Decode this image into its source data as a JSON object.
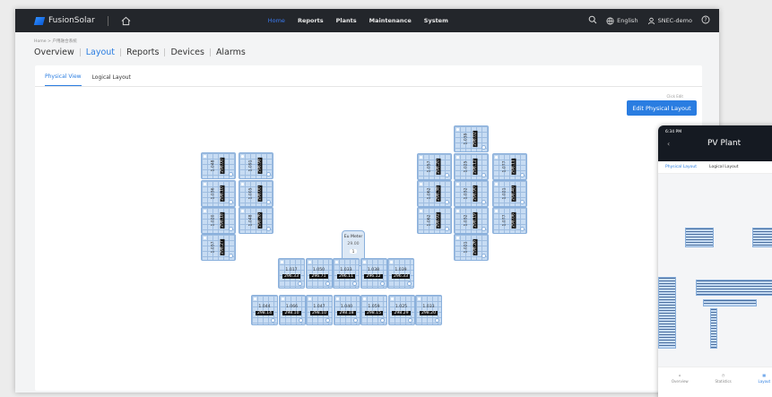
{
  "app": {
    "logo_text": "FusionSolar",
    "nav": [
      {
        "label": "Home",
        "active": true
      },
      {
        "label": "Reports",
        "active": false
      },
      {
        "label": "Plants",
        "active": false
      },
      {
        "label": "Maintenance",
        "active": false
      },
      {
        "label": "System",
        "active": false
      }
    ],
    "language": "English",
    "user": "SNEC-demo"
  },
  "breadcrumb": "Home > 户用融合系统",
  "page_tabs": [
    {
      "label": "Overview",
      "active": false
    },
    {
      "label": "Layout",
      "active": true
    },
    {
      "label": "Reports",
      "active": false
    },
    {
      "label": "Devices",
      "active": false
    },
    {
      "label": "Alarms",
      "active": false
    }
  ],
  "view_tabs": [
    {
      "label": "Physical View",
      "active": true
    },
    {
      "label": "Logical Layout",
      "active": false
    }
  ],
  "click_edit_hint": "Click Edit",
  "edit_button": "Edit Physical Layout",
  "meter": {
    "name": "Eu Meter",
    "value": "29.00",
    "badge": "1"
  },
  "inverters_left": [
    {
      "k": "1.048",
      "v": "298.00"
    },
    {
      "k": "1.091",
      "v": "298.98"
    },
    {
      "k": "1.036",
      "v": "298.10"
    },
    {
      "k": "1.005",
      "v": "298.00"
    },
    {
      "k": "1.020",
      "v": "298.18"
    },
    {
      "k": "1.048",
      "v": "298.26"
    },
    {
      "k": "1.037",
      "v": "298.27"
    }
  ],
  "inverters_right": [
    {
      "k": "1.039",
      "v": "298.02"
    },
    {
      "k": "1.057",
      "v": "298.20"
    },
    {
      "k": "1.025",
      "v": "298.12"
    },
    {
      "k": "1.077",
      "v": "298.11"
    },
    {
      "k": "1.062",
      "v": "298.38"
    },
    {
      "k": "1.032",
      "v": "298.90"
    },
    {
      "k": "1.021",
      "v": "298.40"
    },
    {
      "k": "1.062",
      "v": "298.92"
    },
    {
      "k": "1.032",
      "v": "298.19"
    },
    {
      "k": "1.077",
      "v": "298.06"
    },
    {
      "k": "1.021",
      "v": "298.26"
    }
  ],
  "inverters_row1": [
    {
      "k": "1.017",
      "v": "296.33"
    },
    {
      "k": "1.050",
      "v": "296.71"
    },
    {
      "k": "1.033",
      "v": "296.11"
    },
    {
      "k": "1.038",
      "v": "296.12"
    },
    {
      "k": "1.039",
      "v": "296.33"
    }
  ],
  "inverters_row2": [
    {
      "k": "1.044",
      "v": "298.14"
    },
    {
      "k": "1.066",
      "v": "298.10"
    },
    {
      "k": "1.047",
      "v": "298.10"
    },
    {
      "k": "1.040",
      "v": "298.18"
    },
    {
      "k": "1.059",
      "v": "298.15"
    },
    {
      "k": "1.025",
      "v": "298.29"
    },
    {
      "k": "1.033",
      "v": "298.20"
    }
  ],
  "phone": {
    "time": "6:34 PM",
    "title": "PV Plant",
    "tabs": [
      {
        "label": "Physical Layout",
        "active": true
      },
      {
        "label": "Logical Layout",
        "active": false
      }
    ],
    "bottom_nav": [
      "Overview",
      "Statistics",
      "Layout"
    ]
  }
}
